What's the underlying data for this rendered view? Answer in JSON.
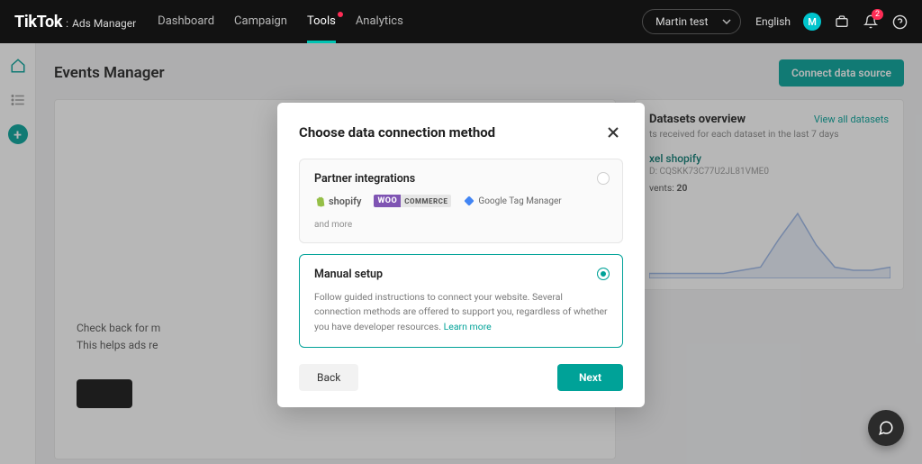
{
  "brand": {
    "name": "TikTok",
    "separator": ":",
    "suffix": "Ads Manager"
  },
  "nav": {
    "items": [
      {
        "label": "Dashboard"
      },
      {
        "label": "Campaign"
      },
      {
        "label": "Tools",
        "active": true,
        "dot": true
      },
      {
        "label": "Analytics"
      }
    ]
  },
  "account": {
    "name": "Martin test"
  },
  "language": "English",
  "avatar_initial": "M",
  "notifications_count": "2",
  "page": {
    "title": "Events Manager",
    "connect_button": "Connect data source",
    "left_text_line1": "Check back for m",
    "left_text_line2": "This helps ads re"
  },
  "datasets": {
    "title": "Datasets overview",
    "view_all": "View all datasets",
    "subtitle": "ts received for each dataset in the last 7 days",
    "item": {
      "name": "xel shopify",
      "id_label": "D: CQSKK73C77U2JL81VME0",
      "events_label": "vents:",
      "events_value": "20"
    }
  },
  "modal": {
    "title": "Choose data connection method",
    "partner": {
      "title": "Partner integrations",
      "shopify": "shopify",
      "woo_left": "WOO",
      "woo_right": "COMMERCE",
      "gtm": "Google Tag Manager",
      "and_more": "and more"
    },
    "manual": {
      "title": "Manual setup",
      "desc": "Follow guided instructions to connect your website. Several connection methods are offered to support you, regardless of whether you have developer resources.",
      "learn_more": "Learn more"
    },
    "back": "Back",
    "next": "Next"
  },
  "chart_data": {
    "type": "area",
    "title": "",
    "x": [
      0,
      1,
      2,
      3,
      4,
      5,
      6,
      7,
      8,
      9,
      10,
      11,
      12,
      13
    ],
    "values": [
      1,
      1,
      1,
      1,
      1,
      2,
      3,
      12,
      20,
      10,
      3,
      2,
      2,
      3
    ],
    "ylim": [
      0,
      20
    ],
    "color": "#9ab6e6"
  }
}
